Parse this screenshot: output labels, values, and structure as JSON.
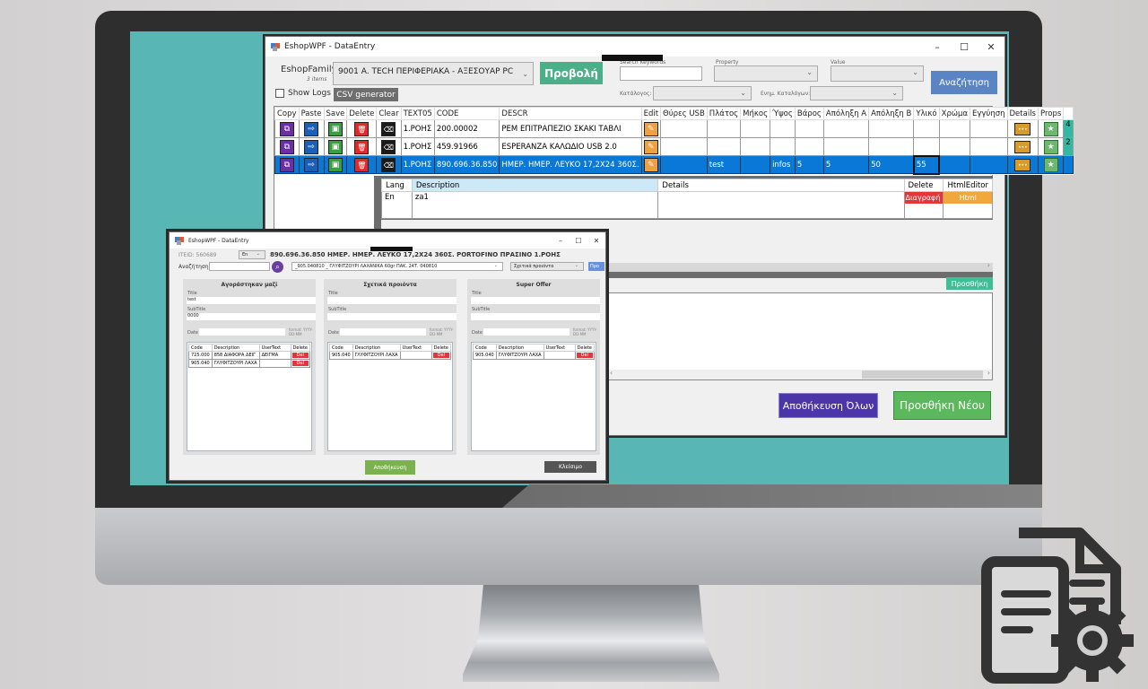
{
  "main_window": {
    "title": "EshopWPF - DataEntry",
    "controls": {
      "minimize": "–",
      "maximize": "☐",
      "close": "✕"
    },
    "eshop_family_label": "EshopFamily:",
    "items_count": "3 items",
    "eshop_family_value": "9001 A. TECH ΠΕΡΙΦΕΡΙΑΚΑ - ΑΞΕΣΟΥΑΡ PC",
    "view_button": "Προβολή",
    "show_logs_label": "Show Logs",
    "csv_button": "CSV generator",
    "search_keywords_label": "Search Keywords",
    "property_label": "Property",
    "value_label": "Value",
    "catalog_label": "Κατάλογος:",
    "catalog_update_label": "Ενημ. Καταλόγων:",
    "search_button": "Αναζήτηση",
    "grid": {
      "columns": [
        "Copy",
        "Paste",
        "Save",
        "Delete",
        "Clear",
        "TEXT05",
        "CODE",
        "DESCR",
        "Edit",
        "Θύρες USB",
        "Πλάτος",
        "Μήκος",
        "Ύψος",
        "Βάρος",
        "Απόληξη Α",
        "Απόληξη Β",
        "Υλικό",
        "Χρώμα",
        "Εγγύηση",
        "Details",
        "Props",
        ""
      ],
      "rows": [
        {
          "text05": "1.ΡΟΗΣ",
          "code": "200.00002",
          "descr": "ΡΕΜ ΕΠΙΤΡΑΠΕΖΙΟ ΣΚΑΚΙ ΤΑΒΛΙ",
          "usb": "",
          "width": "",
          "length": "",
          "height": "",
          "weight": "",
          "end_a": "",
          "end_b": "",
          "material": "",
          "color": "",
          "warranty": "",
          "extra": "4",
          "selected": false
        },
        {
          "text05": "1.ΡΟΗΣ",
          "code": "459.91966",
          "descr": "ESPERANZA ΚΑΛΩΔΙΟ USB 2.0",
          "usb": "",
          "width": "",
          "length": "",
          "height": "",
          "weight": "",
          "end_a": "",
          "end_b": "",
          "material": "",
          "color": "",
          "warranty": "",
          "extra": "2",
          "selected": false
        },
        {
          "text05": "1.ΡΟΗΣ",
          "code": "890.696.36.850",
          "descr": "ΗΜΕΡ. ΗΜΕΡ. ΛΕΥΚΟ 17,2Χ24 360Σ.",
          "usb": "",
          "width": "test",
          "length": "",
          "height": "infos",
          "weight": "5",
          "end_a": "5",
          "end_b": "50",
          "material": "55",
          "color": "",
          "warranty": "",
          "extra": "",
          "selected": true
        }
      ]
    },
    "lang_grid": {
      "columns": [
        "Lang",
        "Description",
        "Details",
        "Delete",
        "HtmlEditor"
      ],
      "rows": [
        {
          "lang": "En",
          "description": "za1",
          "details": "",
          "delete": "Διαγραφή",
          "html": "Html"
        }
      ]
    },
    "add_button": "Προσθήκη",
    "save_all_button": "Αποθήκευση Όλων",
    "add_new_button": "Προσθήκη Νέου"
  },
  "child_window": {
    "title": "EshopWPF - DataEntry",
    "itemid": "ITEID: 560689",
    "lang_value": "En",
    "product_title": "890.696.36.850 ΗΜΕΡ. ΗΜΕΡ. ΛΕΥΚΟ 17,2Χ24 360Σ. PORTOFINO ΠΡΑΣΙΝΟ 1.ΡΟΗΣ",
    "search_label": "Αναζήτηση:",
    "product_combo": "_905.040810 _ ΓΛΥΦΙΤΖΟΥΡΙ ΛΑΧΑΝΙΚΑ 60gr ΠΑΚ. 24Τ. 040810",
    "relation_combo": "Σχετικά προιόντα",
    "relation_button": "Προ",
    "panels": [
      {
        "title": "Αγοράστηκαν μαζί",
        "title_label": "Title",
        "title_value": "test",
        "subtitle_label": "SubTitle",
        "subtitle_value": "0000",
        "date_label": "Date",
        "format_hint": "format: YYYY-DD-MM",
        "columns": [
          "Code",
          "Description",
          "UserText",
          "Delete"
        ],
        "rows": [
          {
            "code": "725.000",
            "description": "858 ΔΙΑΦΟΡΑ ΔΕΙΓ",
            "usertext": "ΔΕΙΓΜΑ",
            "delete": "Del"
          },
          {
            "code": "905.040",
            "description": "ΓΛΥΦΙΤΖΟΥΡΙ ΛΑΧΑ",
            "usertext": "",
            "delete": "Del"
          }
        ]
      },
      {
        "title": "Σχετικά προιόντα",
        "title_label": "Title",
        "title_value": "",
        "subtitle_label": "SubTitle",
        "subtitle_value": "",
        "date_label": "Date",
        "format_hint": "format: YYYY-DD-MM",
        "columns": [
          "Code",
          "Description",
          "UserText",
          "Delete"
        ],
        "rows": [
          {
            "code": "905.040",
            "description": "ΓΛΥΦΙΤΖΟΥΡΙ ΛΑΧΑ",
            "usertext": "",
            "delete": "Del"
          }
        ]
      },
      {
        "title": "Super Offer",
        "title_label": "Title",
        "title_value": "",
        "subtitle_label": "SubTitle",
        "subtitle_value": "",
        "date_label": "Date",
        "format_hint": "format: YYYY-DD-MM",
        "columns": [
          "Code",
          "Description",
          "UserText",
          "Delete"
        ],
        "rows": [
          {
            "code": "905.040",
            "description": "ΓΛΥΦΙΤΖΟΥΡΙ ΛΑΧΑ",
            "usertext": "",
            "delete": "Del"
          }
        ]
      }
    ],
    "save_button": "Αποθήκευση",
    "close_button": "Κλείσιμο"
  },
  "colors": {
    "screen_bg": "#58b6b5",
    "accent_green": "#4caf8a",
    "search_blue": "#5b84c4",
    "save_all_purple": "#4a36a8",
    "add_new_green": "#5cb85c",
    "selection_blue": "#0a78d7",
    "delete_red": "#e5343a",
    "html_orange": "#f0a83c"
  }
}
